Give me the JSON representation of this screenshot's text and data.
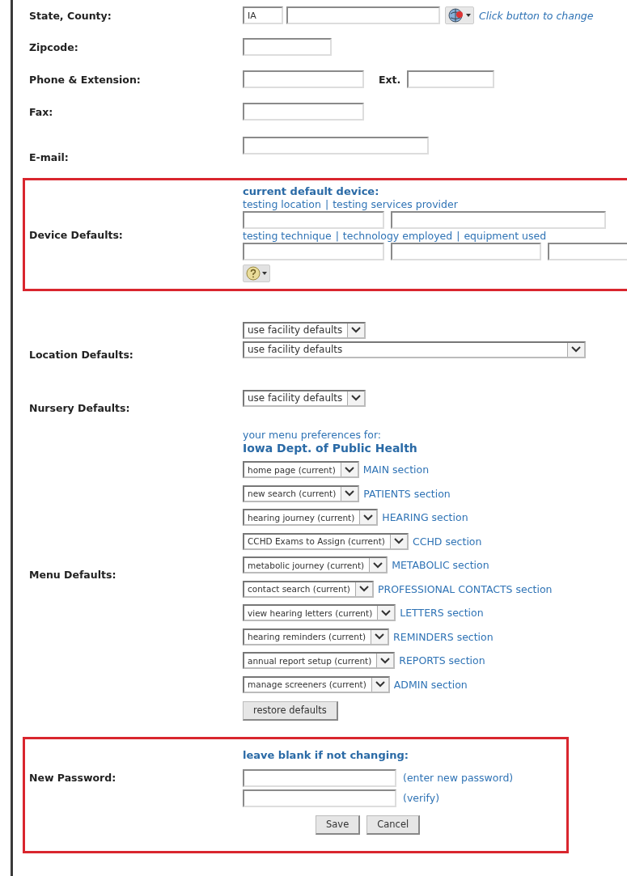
{
  "contact": {
    "state_county": {
      "label": "State, County:",
      "state": "IA",
      "hint": "Click button to change"
    },
    "zipcode": {
      "label": "Zipcode:"
    },
    "phone": {
      "label": "Phone & Extension:",
      "ext_label": "Ext."
    },
    "fax": {
      "label": "Fax:"
    },
    "email": {
      "label": "E-mail:"
    }
  },
  "device_defaults": {
    "label": "Device Defaults:",
    "heading": "current default device:",
    "separator": "|",
    "links_1": [
      "testing location",
      "testing services provider"
    ],
    "links_2": [
      "testing technique",
      "technology employed",
      "equipment used"
    ]
  },
  "location_defaults": {
    "label": "Location Defaults:",
    "selects": [
      "use facility defaults",
      "use facility defaults"
    ]
  },
  "nursery_defaults": {
    "label": "Nursery Defaults:",
    "select": "use facility defaults"
  },
  "menu_defaults": {
    "label": "Menu Defaults:",
    "intro": "your menu preferences for:",
    "organization": "Iowa Dept. of Public Health",
    "rows": [
      {
        "value": "home page (current)",
        "section": "MAIN section"
      },
      {
        "value": "new search (current)",
        "section": "PATIENTS section"
      },
      {
        "value": "hearing journey (current)",
        "section": "HEARING section"
      },
      {
        "value": "CCHD Exams to Assign (current)",
        "section": "CCHD section"
      },
      {
        "value": "metabolic journey (current)",
        "section": "METABOLIC section"
      },
      {
        "value": "contact search (current)",
        "section": "PROFESSIONAL CONTACTS section"
      },
      {
        "value": "view hearing letters (current)",
        "section": "LETTERS section"
      },
      {
        "value": "hearing reminders (current)",
        "section": "REMINDERS section"
      },
      {
        "value": "annual report setup (current)",
        "section": "REPORTS section"
      },
      {
        "value": "manage screeners (current)",
        "section": "ADMIN section"
      }
    ],
    "restore_button": "restore defaults"
  },
  "password": {
    "label": "New Password:",
    "heading": "leave blank if not changing:",
    "new_hint": "(enter new password)",
    "verify_hint": "(verify)",
    "buttons": [
      "Save",
      "Cancel"
    ]
  }
}
